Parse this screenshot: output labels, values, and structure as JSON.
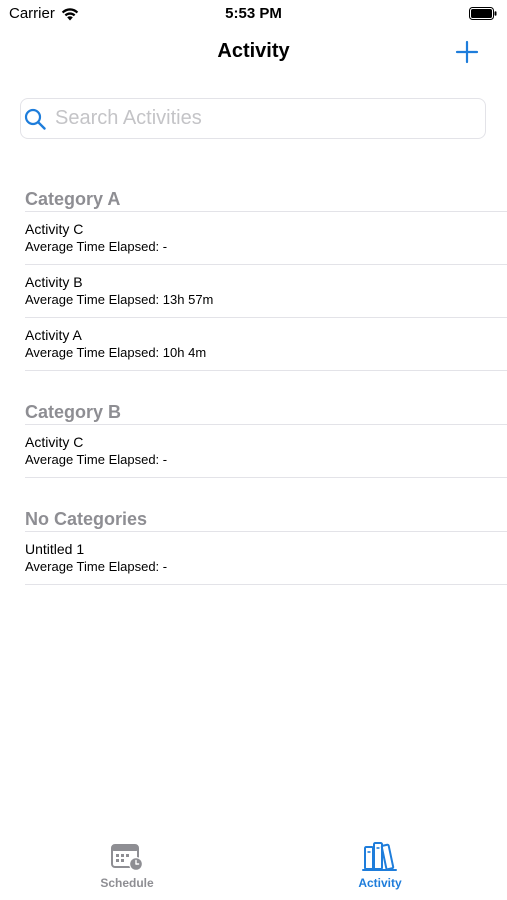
{
  "status_bar": {
    "carrier": "Carrier",
    "time": "5:53 PM"
  },
  "nav": {
    "title": "Activity",
    "add_icon": "plus-icon"
  },
  "search": {
    "placeholder": "Search Activities",
    "value": ""
  },
  "sections": [
    {
      "header": "Category A",
      "rows": [
        {
          "title": "Activity C",
          "subtitle": "Average Time Elapsed: -"
        },
        {
          "title": "Activity B",
          "subtitle": "Average Time Elapsed: 13h 57m"
        },
        {
          "title": "Activity A",
          "subtitle": "Average Time Elapsed: 10h 4m"
        }
      ]
    },
    {
      "header": "Category B",
      "rows": [
        {
          "title": "Activity C",
          "subtitle": "Average Time Elapsed: -"
        }
      ]
    },
    {
      "header": "No Categories",
      "rows": [
        {
          "title": "Untitled 1",
          "subtitle": "Average Time Elapsed: -"
        }
      ]
    }
  ],
  "tab_bar": {
    "tabs": [
      {
        "label": "Schedule",
        "icon": "calendar-clock-icon",
        "selected": false
      },
      {
        "label": "Activity",
        "icon": "books-icon",
        "selected": true
      }
    ]
  },
  "colors": {
    "accent": "#1e7ddb",
    "secondary_text": "#8e8e93",
    "separator": "#e3e3e8"
  }
}
